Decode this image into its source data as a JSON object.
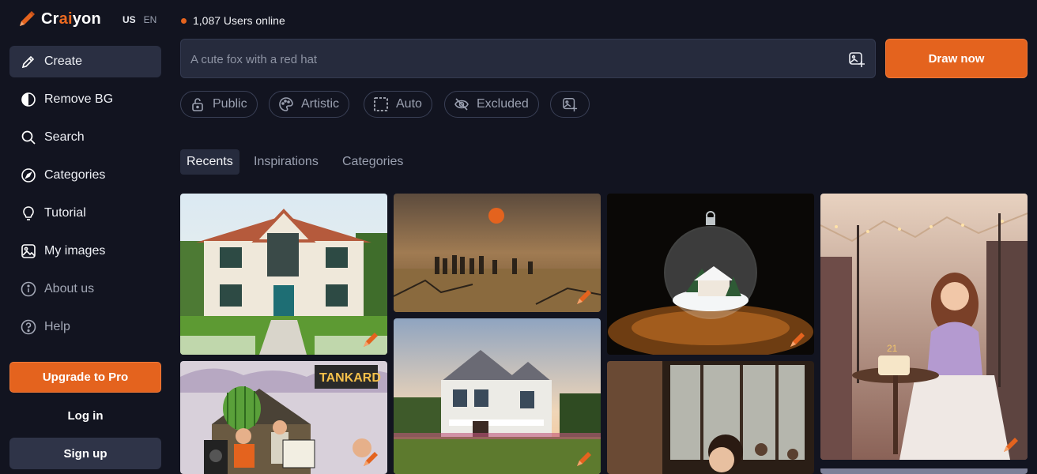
{
  "brand": {
    "name_pre": "Cr",
    "name_ai": "ai",
    "name_post": "yon"
  },
  "language": {
    "region": "US",
    "lang": "EN"
  },
  "sidebar": {
    "items": [
      {
        "label": "Create",
        "icon": "pencil-icon"
      },
      {
        "label": "Remove BG",
        "icon": "half-circle-icon"
      },
      {
        "label": "Search",
        "icon": "search-icon"
      },
      {
        "label": "Categories",
        "icon": "compass-icon"
      },
      {
        "label": "Tutorial",
        "icon": "lightbulb-icon"
      },
      {
        "label": "My images",
        "icon": "image-icon"
      },
      {
        "label": "About us",
        "icon": "info-icon"
      },
      {
        "label": "Help",
        "icon": "question-icon"
      }
    ],
    "upgrade_label": "Upgrade to Pro",
    "login_label": "Log in",
    "signup_label": "Sign up"
  },
  "status": {
    "online_text": "1,087 Users online"
  },
  "prompt": {
    "placeholder": "A cute fox with a red hat",
    "value": ""
  },
  "draw_button": "Draw now",
  "options": [
    {
      "label": "Public",
      "icon": "lock-icon"
    },
    {
      "label": "Artistic",
      "icon": "palette-icon"
    },
    {
      "label": "Auto",
      "icon": "dashed-square-icon"
    },
    {
      "label": "Excluded",
      "icon": "eye-off-icon"
    },
    {
      "label": "",
      "icon": "image-add-icon"
    }
  ],
  "tabs": [
    {
      "label": "Recents",
      "active": true
    },
    {
      "label": "Inspirations",
      "active": false
    },
    {
      "label": "Categories",
      "active": false
    }
  ],
  "gallery": {
    "tiles": [
      {
        "alt": "white two-story house",
        "icon": "edit-brush-icon"
      },
      {
        "alt": "figures walking in desert",
        "icon": "edit-brush-icon"
      },
      {
        "alt": "glass snow globe ornament",
        "icon": "edit-brush-icon"
      },
      {
        "alt": "woman at cafe with birthday cake",
        "icon": "edit-brush-icon"
      },
      {
        "alt": "cartoon festival scene",
        "icon": "edit-brush-icon"
      },
      {
        "alt": "farmhouse at sunset",
        "icon": "edit-brush-icon"
      },
      {
        "alt": "person at laptop in cafe",
        "icon": "edit-brush-icon"
      }
    ],
    "tankard_sign": "TANKARD",
    "cake_number": "21"
  },
  "colors": {
    "background": "#121420",
    "accent": "#e4631e",
    "panel": "#262b3d"
  }
}
